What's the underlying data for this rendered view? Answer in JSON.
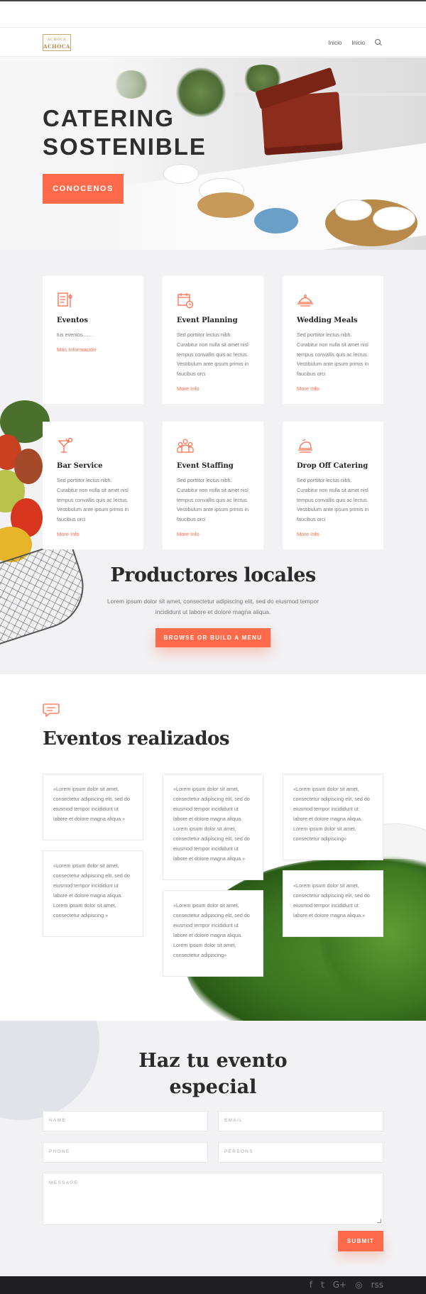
{
  "header": {
    "logo_top": "ACHOCA",
    "logo_main": "ACHOCA",
    "nav": [
      "Inicio",
      "Inicio"
    ]
  },
  "hero": {
    "title": "CATERING SOSTENIBLE",
    "button": "CONOCENOS"
  },
  "services": [
    {
      "icon": "document-icon",
      "title": "Eventos",
      "text": "tus eventos.......",
      "link": "Más Información"
    },
    {
      "icon": "calendar-icon",
      "title": "Event Planning",
      "text": "Sed porttitor lectus nibh. Curabitur non nulla sit amet nisl tempus convallis quis ac lectus. Vestibulum ante ipsum primis in faucibus orci",
      "link": "More Info"
    },
    {
      "icon": "cloche-icon",
      "title": "Wedding Meals",
      "text": "Sed porttitor lectus nibh. Curabitur non nulla sit amet nisl tempus convallis quis ac lectus. Vestibulum ante ipsum primis in faucibus orci",
      "link": "More Info"
    },
    {
      "icon": "cocktail-icon",
      "title": "Bar Service",
      "text": "Sed porttitor lectus nibh. Curabitur non nulla sit amet nisl tempus convallis quis ac lectus. Vestibulum ante ipsum primis in faucibus orci",
      "link": "More Info"
    },
    {
      "icon": "staff-icon",
      "title": "Event Staffing",
      "text": "Sed porttitor lectus nibh. Curabitur non nulla sit amet nisl tempus convallis quis ac lectus. Vestibulum ante ipsum primis in faucibus orci",
      "link": "More Info"
    },
    {
      "icon": "serving-dish-icon",
      "title": "Drop Off Catering",
      "text": "Sed porttitor lectus nibh. Curabitur non nulla sit amet nisl tempus convallis quis ac lectus. Vestibulum ante ipsum primis in faucibus orci",
      "link": "More Info"
    }
  ],
  "producers": {
    "title": "Productores locales",
    "text": "Lorem ipsum dolor sit amet, consectetur adipiscing elit, sed do eiusmod tempor incididunt ut labore et dolore magna aliqua.",
    "button": "BROWSE OR BUILD A MENU"
  },
  "events": {
    "title": "Eventos realizados",
    "quotes": [
      "«Lorem ipsum dolor sit amet, consectetur adipiscing elit, sed do eiusmod tempor incididunt ut labore et dolore magna aliqua.»",
      "«Lorem ipsum dolor sit amet, consectetur adipiscing elit, sed do eiusmod tempor incididunt ut labore et dolore magna aliqua. Lorem ipsum dolor sit amet, consectetur adipiscing »",
      "«Lorem ipsum dolor sit amet, consectetur adipiscing elit, sed do eiusmod tempor incididunt ut labore et dolore magna aliqua. Lorem ipsum dolor sit amet, consectetur adipiscing elit, sed do eiusmod tempor incididunt ut labore et dolore magna aliqua.»",
      "«Lorem ipsum dolor sit amet, consectetur adipiscing elit, sed do eiusmod tempor incididunt ut labore et dolore magna aliqua. Lorem ipsum dolor sit amet, consectetur adipiscing»",
      "«Lorem ipsum dolor sit amet, consectetur adipiscing elit, sed do eiusmod tempor incididunt ut labore et dolore magna aliqua. Lorem ipsum dolor sit amet, consectetur adipiscing»",
      "«Lorem ipsum dolor sit amet, consectetur adipiscing elit, sed do eiusmod tempor incididunt ut labore et dolore magna aliqua.»"
    ]
  },
  "contact": {
    "title_line1": "Haz tu evento",
    "title_line2": "especial",
    "name": "NAME",
    "email": "EMAIL",
    "phone": "PHONE",
    "persons": "PERSONS",
    "message": "MESSAGE",
    "submit": "SUBMIT"
  },
  "footer": {
    "social": [
      "f",
      "t",
      "G+",
      "◎",
      "rss"
    ]
  },
  "colors": {
    "accent": "#ff6b4a",
    "section_bg": "#f2f2f4",
    "footer_bg": "#1f1f23"
  }
}
